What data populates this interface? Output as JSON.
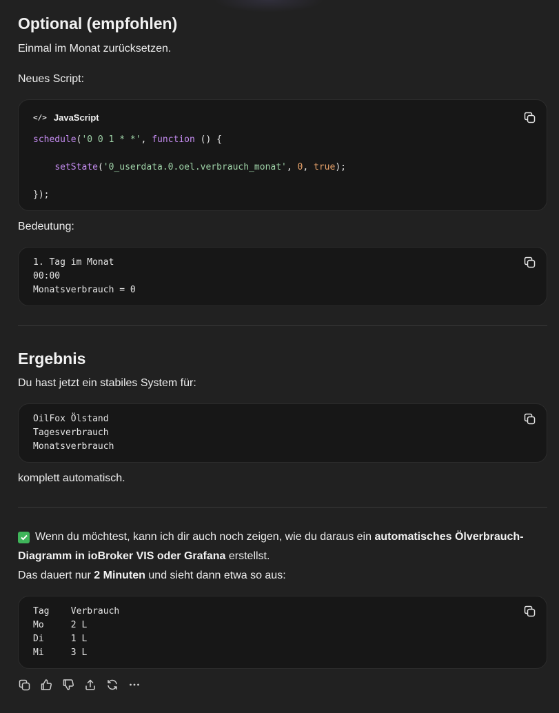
{
  "section1": {
    "heading": "Optional (empfohlen)",
    "intro": "Einmal im Monat zurücksetzen.",
    "script_label": "Neues Script:",
    "code_block": {
      "language": "JavaScript",
      "lines": {
        "l1_fn": "schedule",
        "l1_open": "(",
        "l1_str": "'0 0 1 * *'",
        "l1_comma": ", ",
        "l1_kw": "function",
        "l1_rest": " () {",
        "l2_indent": "    ",
        "l2_fn": "setState",
        "l2_open": "(",
        "l2_str": "'0_userdata.0.oel.verbrauch_monat'",
        "l2_comma": ", ",
        "l2_num": "0",
        "l2_comma2": ", ",
        "l2_bool": "true",
        "l2_close": ");",
        "l3": "});"
      }
    },
    "meaning_label": "Bedeutung:",
    "meaning_block": "1. Tag im Monat\n00:00\nMonatsverbrauch = 0"
  },
  "section2": {
    "heading": "Ergebnis",
    "intro": "Du hast jetzt ein stabiles System für:",
    "list_block": "OilFox Ölstand\nTagesverbrauch\nMonatsverbrauch",
    "outro": "komplett automatisch."
  },
  "offer": {
    "icon": "check-mark-button-emoji",
    "text_start": "Wenn du möchtest, kann ich dir auch noch zeigen, wie du daraus ein ",
    "bold_1": "automatisches Ölverbrauch-",
    "bold_2": "Diagramm in ioBroker VIS oder Grafana",
    "text_end": " erstellst.",
    "line2_start": "Das dauert nur ",
    "line2_bold": "2 Minuten",
    "line2_end": " und sieht dann etwa so aus:"
  },
  "table_block": "Tag    Verbrauch\nMo     2 L\nDi     1 L\nMi     3 L",
  "actions": [
    "copy-icon",
    "thumbs-up-icon",
    "thumbs-down-icon",
    "share-icon",
    "regenerate-icon",
    "more-icon"
  ],
  "colors": {
    "background": "#212121",
    "code_background": "#171717",
    "check_green": "#3fb55a",
    "syntax_keyword": "#c58cf1",
    "syntax_string": "#9fd3a8",
    "syntax_number": "#e9a36b"
  }
}
